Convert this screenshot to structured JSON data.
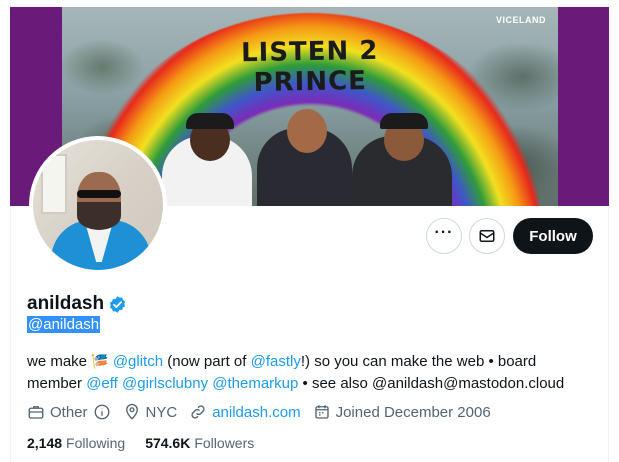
{
  "banner": {
    "headline": "LISTEN 2 PRINCE",
    "network": "VICELAND"
  },
  "actions": {
    "more_icon": "ellipsis-icon",
    "message_icon": "envelope-icon",
    "follow_label": "Follow"
  },
  "profile": {
    "name": "anildash",
    "handle": "@anildash",
    "bio": {
      "p1": "we make ",
      "emoji": "🎏",
      "glitch": "@glitch",
      "p2": " (now part of ",
      "fastly": "@fastly",
      "p3": "!) so you can make the web • board member ",
      "eff": "@eff",
      "girlsclubny": "@girlsclubny",
      "themarkup": "@themarkup",
      "p4": " • see also @anildash@mastodon.cloud"
    },
    "meta": {
      "category": "Other",
      "location": "NYC",
      "website": "anildash.com",
      "joined": "Joined December 2006"
    },
    "stats": {
      "following_count": "2,148",
      "following_label": "Following",
      "followers_count": "574.6K",
      "followers_label": "Followers"
    }
  },
  "colors": {
    "accent": "#1d9bf0",
    "follow_bg": "#0f1419",
    "banner_bg": "#6a1a78",
    "selection": "#3390ff"
  }
}
